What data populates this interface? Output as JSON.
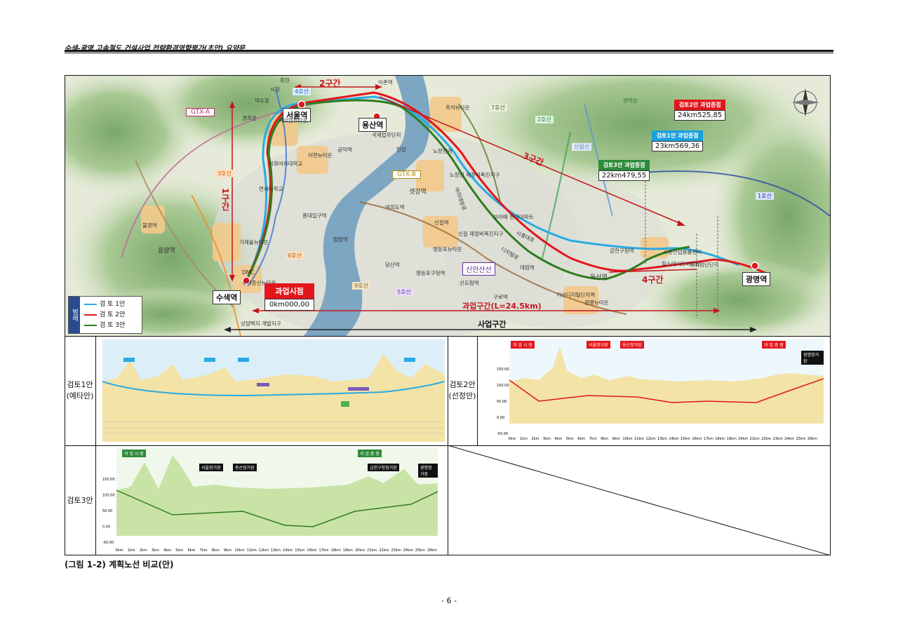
{
  "header": {
    "title": "수색-광명 고속철도 건설사업 전략환경영향평가(초안) 요약문"
  },
  "map": {
    "sections": [
      "1구간",
      "2구간",
      "3구간",
      "4구간"
    ],
    "stations": [
      "서울역",
      "용산역",
      "수색역",
      "광명역"
    ],
    "lines": [
      "GTX-A",
      "GTX-B",
      "3호선",
      "4호선",
      "6호선",
      "9호선",
      "5호선",
      "7호선",
      "2호선",
      "1호선",
      "신림선",
      "신안산선"
    ],
    "places": [
      "이촌역",
      "공덕역",
      "홍대입구역",
      "합정역",
      "샛강역",
      "여의도역",
      "노량진역",
      "당산역",
      "영등포구청역",
      "신도림역",
      "구로역",
      "독산역",
      "대림역",
      "금천구청역",
      "불광역",
      "응암역",
      "신길역",
      "가산디지털단지역",
      "시청",
      "회현",
      "덕수궁",
      "경희궁",
      "국제업무단지",
      "한강",
      "여의대방로",
      "시흥대로",
      "디지털로",
      "관악산",
      "아현뉴타운",
      "북아현뉴타운",
      "흑석뉴타운",
      "가재울뉴타운",
      "신길 재정비촉진지구",
      "노량진 재정비촉진지구",
      "영등포뉴타운",
      "수색증산뉴타운",
      "광명뉴타운",
      "연세대학교",
      "이화여자대학교",
      "시흥산업용품센터",
      "힐스테이트아파트",
      "도시첨단단지",
      "보라매 현대아파트",
      "상암택지 개발지구",
      "DMC"
    ],
    "legend": {
      "title": "범례",
      "items": [
        "검 토 1안",
        "검 토 2안",
        "검 토 3안"
      ],
      "colors": [
        "#29abe2",
        "#e3161c",
        "#2e7d1f"
      ]
    },
    "callouts": [
      {
        "label": "검토2안 과업종점",
        "value": "24km525,85",
        "color": "#e3161c"
      },
      {
        "label": "검토1안 과업종점",
        "value": "23km569,36",
        "color": "#1aa0dc"
      },
      {
        "label": "검토3안 과업종점",
        "value": "22km479,55",
        "color": "#2e8b3a"
      },
      {
        "label": "과업시점",
        "value": "0km000,00",
        "color": "#e3161c"
      }
    ],
    "spans": {
      "task": "과업구간(L=24.5km)",
      "project": "사업구간"
    }
  },
  "profiles": {
    "p1": {
      "name": "검토1안",
      "sub": "(예타안)"
    },
    "p2": {
      "name": "검토2안",
      "sub": "(선정안)",
      "labels": [
        "과 업 시 점",
        "서울정거장",
        "용산정거장",
        "과 업 종 점",
        "광명정거장"
      ],
      "yticks": [
        "150.00",
        "100.00",
        "50.00",
        "0.00",
        "-50.00"
      ],
      "xticks": [
        "0km",
        "1km",
        "2km",
        "3km",
        "4km",
        "5km",
        "6km",
        "7km",
        "8km",
        "9km",
        "10km",
        "11km",
        "12km",
        "13km",
        "14km",
        "15km",
        "16km",
        "17km",
        "18km",
        "19km",
        "20km",
        "21km",
        "22km",
        "23km",
        "24km",
        "25km",
        "26km"
      ]
    },
    "p3": {
      "name": "검토3안",
      "labels": [
        "과 업 시 점",
        "서울정거장",
        "용산정거장",
        "과 업 종 점",
        "금천구청정거장",
        "광명정거장"
      ],
      "yticks": [
        "150.00",
        "100.00",
        "50.00",
        "0.00",
        "-50.00"
      ],
      "xticks": [
        "0km",
        "1km",
        "2km",
        "3km",
        "4km",
        "5km",
        "6km",
        "7km",
        "8km",
        "9km",
        "10km",
        "11km",
        "12km",
        "13km",
        "14km",
        "15km",
        "16km",
        "17km",
        "18km",
        "19km",
        "20km",
        "21km",
        "22km",
        "23km",
        "24km",
        "25km",
        "26km"
      ]
    }
  },
  "caption": "(그림 1-2) 계획노선 비교(안)",
  "page_number": "- 6 -"
}
